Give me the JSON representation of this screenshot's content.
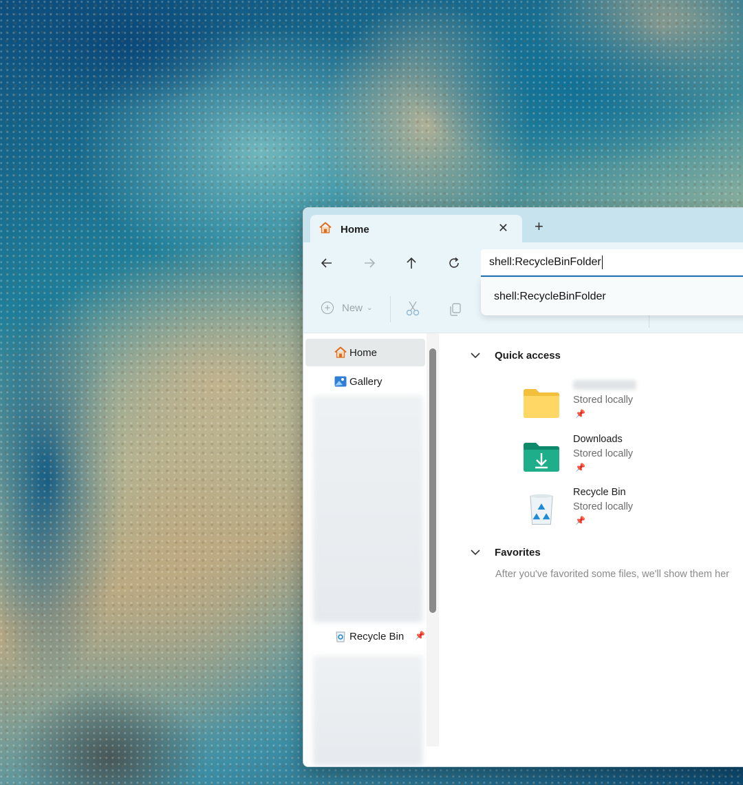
{
  "window": {
    "tab_title": "Home",
    "tab_close": "✕",
    "new_tab": "+"
  },
  "navigation": {
    "back_icon": "arrow-left-icon",
    "forward_icon": "arrow-right-icon",
    "up_icon": "arrow-up-icon",
    "refresh_icon": "refresh-icon"
  },
  "address": {
    "value": "shell:RecycleBinFolder",
    "suggestion": "shell:RecycleBinFolder"
  },
  "command_bar": {
    "new_label": "New",
    "cut_icon": "scissors-icon",
    "copy_icon": "copy-icon"
  },
  "sidebar": {
    "items": [
      {
        "label": "Home",
        "icon": "home-icon",
        "selected": true
      },
      {
        "label": "Gallery",
        "icon": "gallery-icon"
      },
      {
        "label": "Recycle Bin",
        "icon": "recycle-bin-icon",
        "pinned": true
      }
    ]
  },
  "main": {
    "quick_access": {
      "title": "Quick access",
      "items": [
        {
          "name": "",
          "sub": "Stored locally",
          "icon": "folder-icon",
          "pinned": true
        },
        {
          "name": "Downloads",
          "sub": "Stored locally",
          "icon": "downloads-folder-icon",
          "pinned": true
        },
        {
          "name": "Recycle Bin",
          "sub": "Stored locally",
          "icon": "recycle-bin-icon",
          "pinned": true
        }
      ]
    },
    "favorites": {
      "title": "Favorites",
      "empty_text": "After you've favorited some files, we'll show them her"
    }
  },
  "colors": {
    "titlebar": "#c7e4ee",
    "toolbar": "#eaf5f9",
    "accent": "#1f6fb2"
  }
}
